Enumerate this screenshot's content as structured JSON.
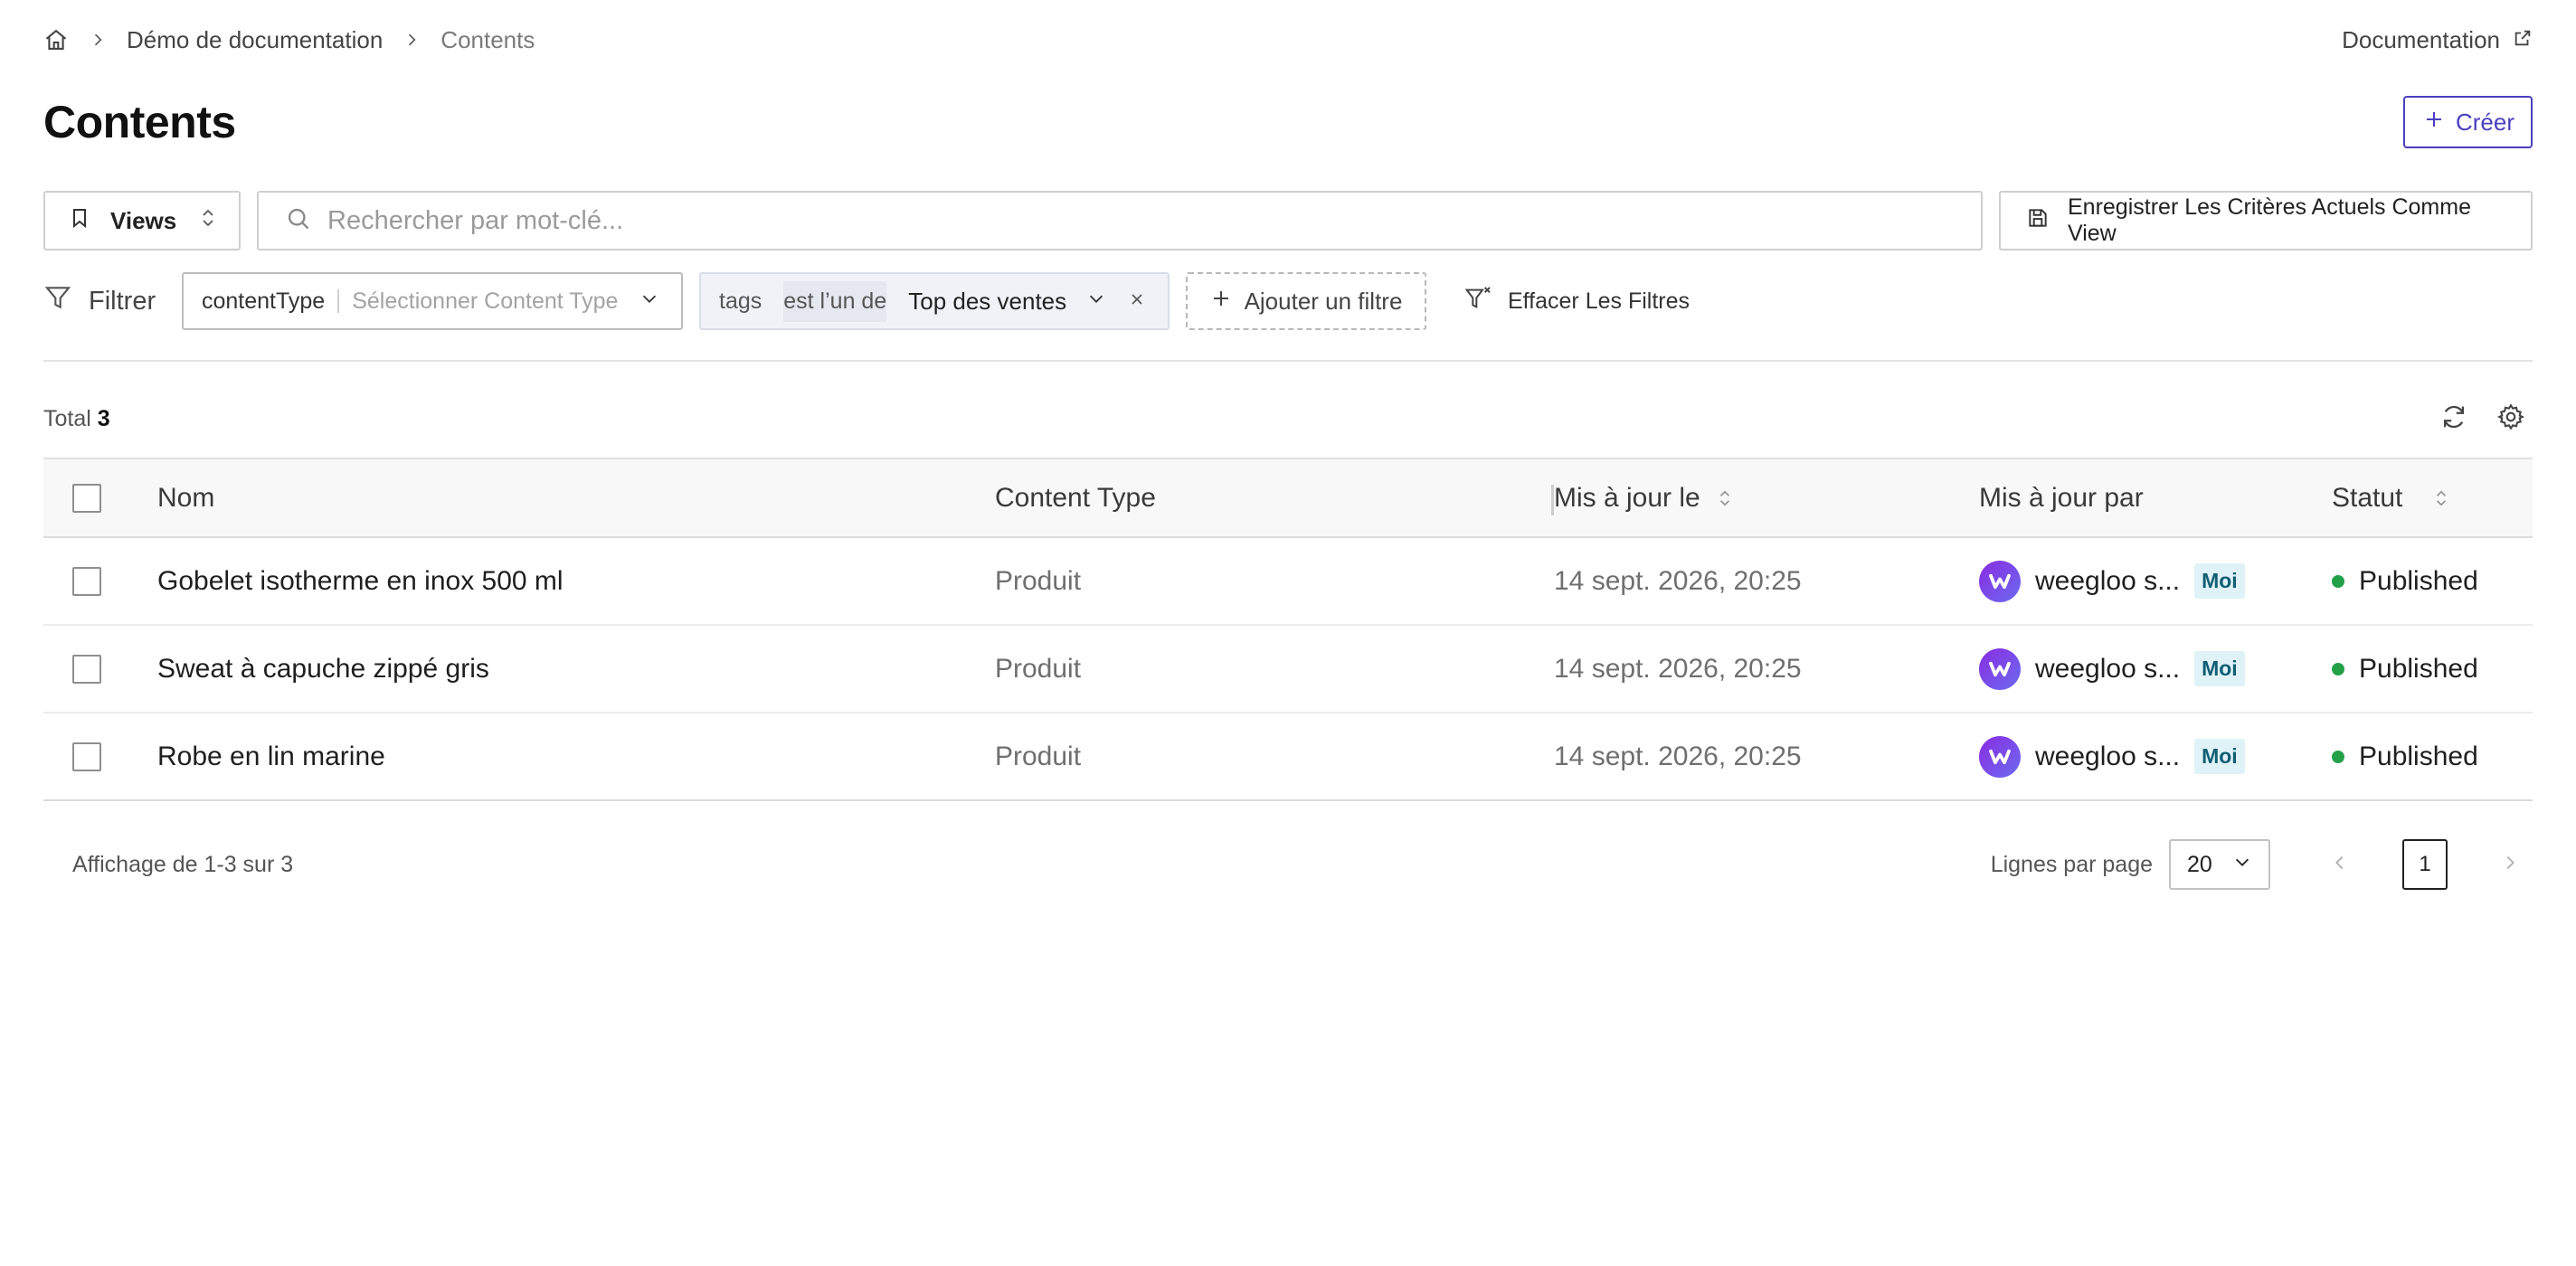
{
  "breadcrumb": {
    "items": [
      "Démo de documentation",
      "Contents"
    ]
  },
  "header": {
    "documentation_link": "Documentation",
    "title": "Contents",
    "create_label": "Créer"
  },
  "toolbar": {
    "views_label": "Views",
    "search_placeholder": "Rechercher par mot-clé...",
    "save_view_label": "Enregistrer Les Critères Actuels Comme View"
  },
  "filters": {
    "label": "Filtrer",
    "content_type": {
      "key": "contentType",
      "placeholder": "Sélectionner Content Type"
    },
    "tags": {
      "key": "tags",
      "operator": "est l’un de",
      "value": "Top des ventes"
    },
    "add_label": "Ajouter un filtre",
    "clear_label": "Effacer Les Filtres"
  },
  "summary": {
    "total_label": "Total",
    "total_count": "3"
  },
  "table": {
    "columns": {
      "name": "Nom",
      "content_type": "Content Type",
      "updated_at": "Mis à jour le",
      "updated_by": "Mis à jour par",
      "status": "Statut"
    },
    "rows": [
      {
        "name": "Gobelet isotherme en inox 500 ml",
        "content_type": "Produit",
        "updated_at": "14 sept. 2026, 20:25",
        "updated_by": "weegloo s...",
        "badge": "Moi",
        "status": "Published"
      },
      {
        "name": "Sweat à capuche zippé gris",
        "content_type": "Produit",
        "updated_at": "14 sept. 2026, 20:25",
        "updated_by": "weegloo s...",
        "badge": "Moi",
        "status": "Published"
      },
      {
        "name": "Robe en lin marine",
        "content_type": "Produit",
        "updated_at": "14 sept. 2026, 20:25",
        "updated_by": "weegloo s...",
        "badge": "Moi",
        "status": "Published"
      }
    ]
  },
  "pagination": {
    "showing": "Affichage de 1-3 sur 3",
    "rows_per_page_label": "Lignes par page",
    "page_size": "20",
    "current_page": "1"
  },
  "colors": {
    "accent": "#4a3fbf",
    "status_published": "#24a148",
    "badge_bg": "#dff2f7",
    "badge_text": "#0f5e73"
  },
  "icons": [
    "home-icon",
    "chevron-right-icon",
    "external-link-icon",
    "plus-icon",
    "bookmark-icon",
    "sort-icon",
    "search-icon",
    "save-icon",
    "filter-icon",
    "chevron-down-icon",
    "close-icon",
    "clear-filter-icon",
    "refresh-icon",
    "gear-icon",
    "chevron-left-icon",
    "avatar-logo-icon"
  ]
}
